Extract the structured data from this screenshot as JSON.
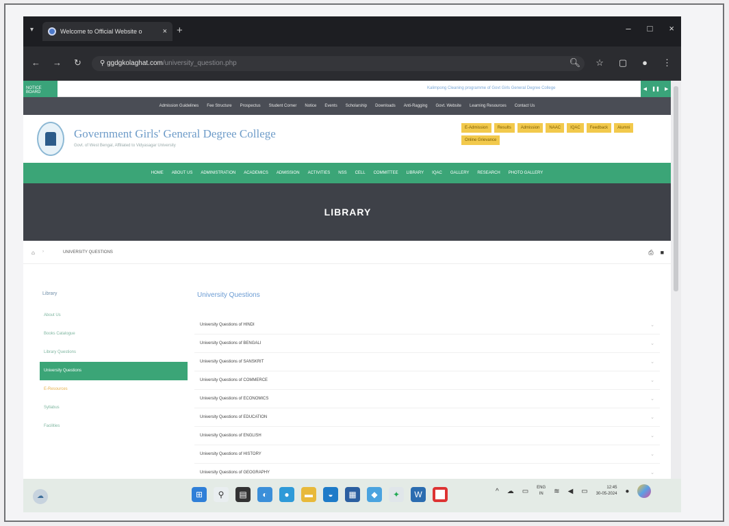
{
  "browser": {
    "tab_title": "Welcome to Official Website o",
    "tab_close": "×",
    "new_tab": "+",
    "url_domain": "ggdgkolaghat.com",
    "url_path": "/university_question.php",
    "window_controls": [
      "–",
      "□",
      "×"
    ]
  },
  "notice": {
    "label": "NOTICE BOARD",
    "ticker": "Kalimpong Cleaning programme of Govt Girls General Degree College",
    "controls": [
      "◀",
      "❚❚",
      "▶"
    ]
  },
  "top_nav": [
    "Admission Guidelines",
    "Fee Structure",
    "Prospectus",
    "Student Corner",
    "Notice",
    "Events",
    "Scholarship",
    "Downloads",
    "Anti-Ragging",
    "Govt. Website",
    "Learning Resources",
    "Contact Us"
  ],
  "header": {
    "college_name": "Government Girls' General Degree College",
    "tagline": "Govt. of West Bengal, Affiliated to Vidyasagar University",
    "quick_links": [
      "E-Admission",
      "Results",
      "Admission",
      "NAAC",
      "IQAC",
      "Feedback",
      "Alumni",
      "Online Grievance"
    ]
  },
  "main_nav": [
    "HOME",
    "ABOUT US",
    "ADMINISTRATION",
    "ACADEMICS",
    "ADMISSION",
    "ACTIVITIES",
    "NSS",
    "CELL",
    "COMMITTEE",
    "LIBRARY",
    "IQAC",
    "GALLERY",
    "RESEARCH",
    "PHOTO GALLERY"
  ],
  "banner": {
    "title": "LIBRARY"
  },
  "breadcrumb": {
    "home": "⌂",
    "separator": "›",
    "current": "UNIVERSITY QUESTIONS"
  },
  "sidebar": {
    "title": "Library",
    "items": [
      {
        "label": "About Us",
        "style": "normal"
      },
      {
        "label": "Books Catalogue",
        "style": "normal"
      },
      {
        "label": "Library Questions",
        "style": "normal"
      },
      {
        "label": "University Questions",
        "style": "active"
      },
      {
        "label": "E-Resources",
        "style": "gold"
      },
      {
        "label": "Syllabus",
        "style": "normal"
      },
      {
        "label": "Facilities",
        "style": "normal"
      }
    ]
  },
  "content": {
    "heading": "University Questions",
    "rows": [
      "University Questions of HINDI",
      "University Questions of BENGALI",
      "University Questions of SANSKRIT",
      "University Questions of COMMERCE",
      "University Questions of ECONOMICS",
      "University Questions of EDUCATION",
      "University Questions of ENGLISH",
      "University Questions of HISTORY",
      "University Questions of GEOGRAPHY"
    ],
    "row_chevron": "⌄"
  },
  "taskbar": {
    "language": "ENG",
    "region": "IN",
    "time": "12:45",
    "date": "30-05-2024"
  },
  "colors": {
    "accent_green": "#3ba577",
    "quick_link_gold": "#f2c94c",
    "banner_gray": "#3e4148"
  }
}
